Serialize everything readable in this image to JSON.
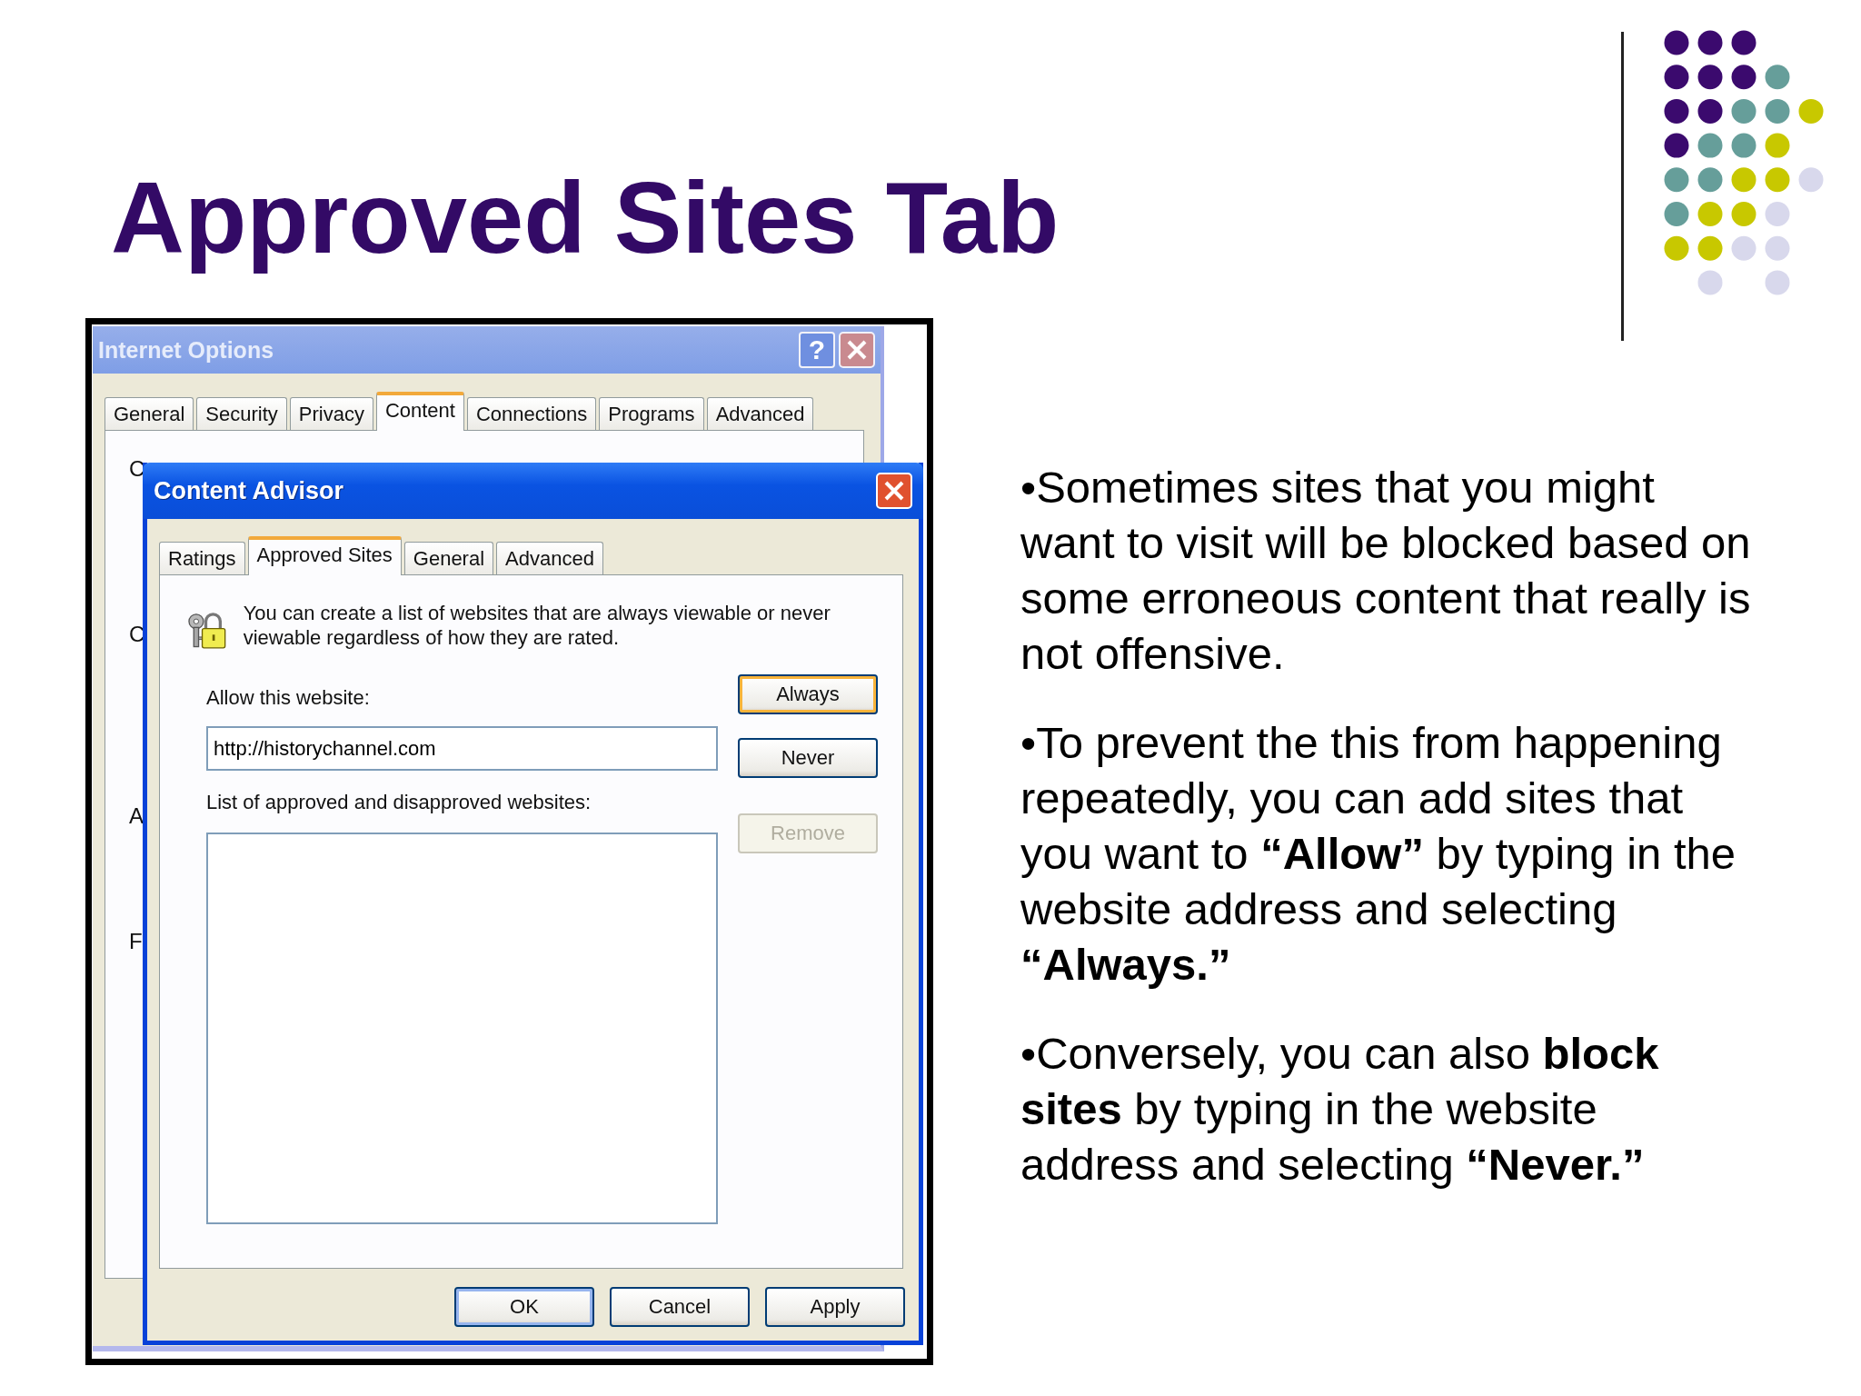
{
  "slide": {
    "title": "Approved Sites Tab"
  },
  "screenshot": {
    "back_window": {
      "title": "Internet Options",
      "help_button": "?",
      "tabs": [
        {
          "label": "General",
          "selected": false
        },
        {
          "label": "Security",
          "selected": false
        },
        {
          "label": "Privacy",
          "selected": false
        },
        {
          "label": "Content",
          "selected": true
        },
        {
          "label": "Connections",
          "selected": false
        },
        {
          "label": "Programs",
          "selected": false
        },
        {
          "label": "Advanced",
          "selected": false
        }
      ],
      "covered_labels": [
        "C",
        "C",
        "A",
        "F"
      ]
    },
    "dialog": {
      "title": "Content Advisor",
      "tabs": [
        {
          "label": "Ratings",
          "selected": false
        },
        {
          "label": "Approved Sites",
          "selected": true
        },
        {
          "label": "General",
          "selected": false
        },
        {
          "label": "Advanced",
          "selected": false
        }
      ],
      "description": "You can create a list of websites that are always viewable or never viewable regardless of how they are rated.",
      "allow_label": "Allow this website:",
      "website_field": {
        "value": "http://historychannel.com"
      },
      "side_buttons": [
        {
          "label": "Always",
          "focused": true,
          "disabled": false
        },
        {
          "label": "Never",
          "focused": false,
          "disabled": false
        },
        {
          "label": "Remove",
          "focused": false,
          "disabled": true
        }
      ],
      "list_label": "List of approved and disapproved websites:",
      "footer_buttons": [
        {
          "label": "OK",
          "default": true
        },
        {
          "label": "Cancel",
          "default": false
        },
        {
          "label": "Apply",
          "default": false
        }
      ]
    }
  },
  "bullets": [
    "•Sometimes sites that you might want to visit will be blocked based on some erroneous content that really is not offensive.",
    "•To prevent the this from happening repeatedly, you can add sites that you want to **“Allow”** by typing in the website address and selecting **“Always.”**",
    "•Conversely, you can also **block sites** by typing in the website address and selecting **“Never.”**"
  ]
}
